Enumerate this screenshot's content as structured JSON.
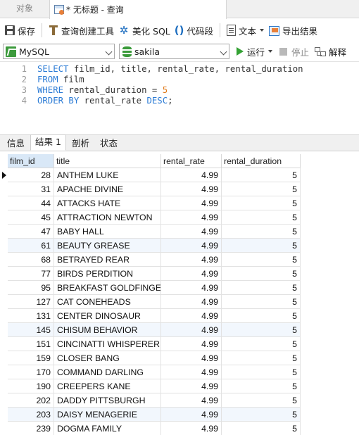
{
  "tabs": {
    "objects_label": "对象",
    "query_label": "* 无标题 - 查询"
  },
  "toolbar": {
    "save": "保存",
    "query_builder": "查询创建工具",
    "beautify_sql": "美化 SQL",
    "code_snippet": "代码段",
    "text": "文本",
    "export_result": "导出结果"
  },
  "toolbar2": {
    "connection": "MySQL",
    "database": "sakila",
    "run": "运行",
    "stop": "停止",
    "explain": "解释"
  },
  "editor": {
    "lines": [
      {
        "n": "1",
        "parts": [
          {
            "t": "SELECT",
            "k": "kw"
          },
          {
            "t": " film_id, title, rental_rate, rental_duration",
            "k": ""
          }
        ]
      },
      {
        "n": "2",
        "parts": [
          {
            "t": "FROM",
            "k": "kw"
          },
          {
            "t": " film",
            "k": ""
          }
        ]
      },
      {
        "n": "3",
        "parts": [
          {
            "t": "WHERE",
            "k": "kw"
          },
          {
            "t": " rental_duration = ",
            "k": ""
          },
          {
            "t": "5",
            "k": "num"
          }
        ]
      },
      {
        "n": "4",
        "parts": [
          {
            "t": "ORDER BY",
            "k": "kw"
          },
          {
            "t": " rental_rate ",
            "k": ""
          },
          {
            "t": "DESC",
            "k": "kw"
          },
          {
            "t": ";",
            "k": ""
          }
        ]
      }
    ]
  },
  "result_tabs": [
    "信息",
    "结果 1",
    "剖析",
    "状态"
  ],
  "active_result_tab": 1,
  "grid": {
    "columns": [
      "film_id",
      "title",
      "rental_rate",
      "rental_duration"
    ],
    "rows": [
      [
        "28",
        "ANTHEM LUKE",
        "4.99",
        "5"
      ],
      [
        "31",
        "APACHE DIVINE",
        "4.99",
        "5"
      ],
      [
        "44",
        "ATTACKS HATE",
        "4.99",
        "5"
      ],
      [
        "45",
        "ATTRACTION NEWTON",
        "4.99",
        "5"
      ],
      [
        "47",
        "BABY HALL",
        "4.99",
        "5"
      ],
      [
        "61",
        "BEAUTY GREASE",
        "4.99",
        "5"
      ],
      [
        "68",
        "BETRAYED REAR",
        "4.99",
        "5"
      ],
      [
        "77",
        "BIRDS PERDITION",
        "4.99",
        "5"
      ],
      [
        "95",
        "BREAKFAST GOLDFINGER",
        "4.99",
        "5"
      ],
      [
        "127",
        "CAT CONEHEADS",
        "4.99",
        "5"
      ],
      [
        "131",
        "CENTER DINOSAUR",
        "4.99",
        "5"
      ],
      [
        "145",
        "CHISUM BEHAVIOR",
        "4.99",
        "5"
      ],
      [
        "151",
        "CINCINATTI WHISPERER",
        "4.99",
        "5"
      ],
      [
        "159",
        "CLOSER BANG",
        "4.99",
        "5"
      ],
      [
        "170",
        "COMMAND DARLING",
        "4.99",
        "5"
      ],
      [
        "190",
        "CREEPERS KANE",
        "4.99",
        "5"
      ],
      [
        "202",
        "DADDY PITTSBURGH",
        "4.99",
        "5"
      ],
      [
        "203",
        "DAISY MENAGERIE",
        "4.99",
        "5"
      ],
      [
        "239",
        "DOGMA FAMILY",
        "4.99",
        "5"
      ]
    ]
  },
  "colors": {
    "keyword": "#2b7bd5",
    "number": "#e07a1a",
    "selected_header": "#d9e8f7",
    "alt_row": "#f2f7fd"
  }
}
